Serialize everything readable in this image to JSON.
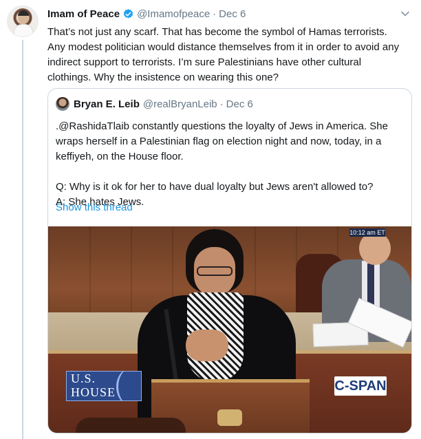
{
  "tweet": {
    "display_name": "Imam of Peace",
    "handle": "@Imamofpeace",
    "separator": "·",
    "date": "Dec 6",
    "text": "That’s not just any scarf. That has become the symbol of Hamas terrorists. Any modest politician would distance themselves from it in order to avoid any indirect support to terrorists. I’m sure Palestinians have other cultural clothings. Why the insistence on wearing this one?",
    "verified_icon": "verified-badge-icon",
    "caret_icon": "chevron-down-icon"
  },
  "quote": {
    "display_name": "Bryan E. Leib",
    "handle": "@realBryanLeib",
    "separator": "·",
    "date": "Dec 6",
    "paragraphs": [
      ".@RashidaTlaib constantly questions the loyalty of Jews in America.  She wraps herself in a Palestinian flag on election night and now, today, in a keffiyeh, on the House floor.",
      "",
      "Q: Why is it ok for her to have dual loyalty but Jews aren't allowed to?",
      "A: She hates Jews."
    ],
    "show_thread": "Show this thread",
    "media": {
      "clock": "10:12 am ET",
      "house_logo_line1": "U.S.",
      "house_logo_line2": "HOUSE",
      "network_logo": "C-SPAN"
    }
  },
  "colors": {
    "link": "#1b95e0",
    "verified": "#1da1f2",
    "secondary_text": "#657786",
    "border": "#ccd6dd"
  }
}
